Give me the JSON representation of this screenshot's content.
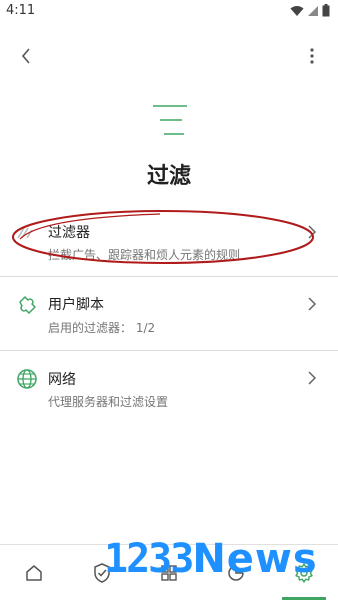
{
  "status_bar": {
    "time": "4:11"
  },
  "page": {
    "title": "过滤"
  },
  "items": [
    {
      "title": "过滤器",
      "subtitle": "拦截广告、跟踪器和烦人元素的规则",
      "icon": "filter-icon"
    },
    {
      "title": "用户脚本",
      "subtitle": "启用的过滤器： 1/2",
      "icon": "puzzle-icon"
    },
    {
      "title": "网络",
      "subtitle": "代理服务器和过滤设置",
      "icon": "globe-icon"
    }
  ],
  "bottom_nav": [
    {
      "icon": "home-icon"
    },
    {
      "icon": "shield-check-icon"
    },
    {
      "icon": "grid-icon"
    },
    {
      "icon": "stats-icon"
    },
    {
      "icon": "settings-gear-icon",
      "active": true
    }
  ],
  "watermark": {
    "digits": "1233",
    "word": "News"
  },
  "colors": {
    "accent": "#3fa564",
    "annotation": "#b01a1a",
    "watermark": "#1e90ff"
  }
}
